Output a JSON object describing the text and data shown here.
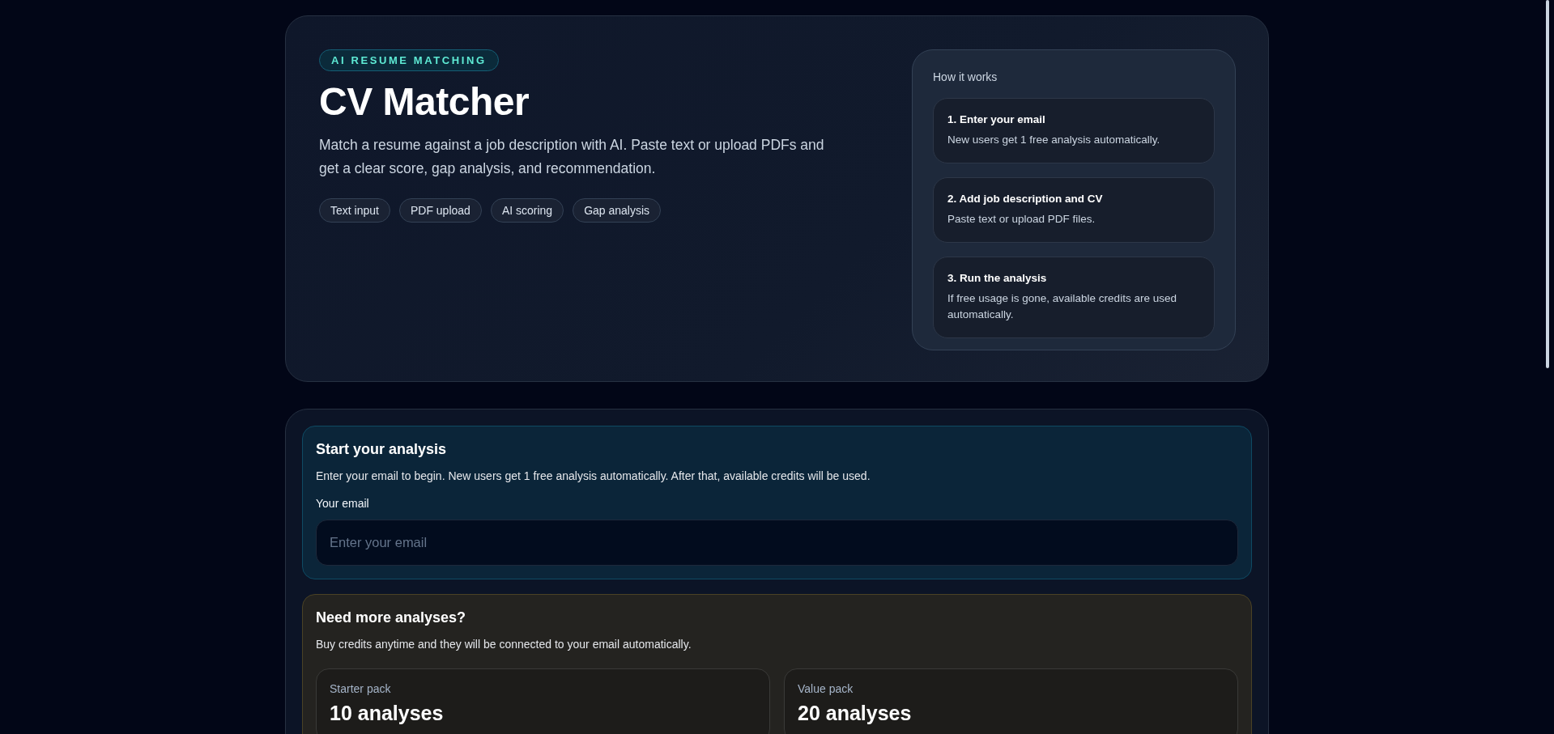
{
  "hero": {
    "badge": "AI RESUME MATCHING",
    "title": "CV Matcher",
    "description": "Match a resume against a job description with AI. Paste text or upload PDFs and get a clear score, gap analysis, and recommendation.",
    "features": [
      "Text input",
      "PDF upload",
      "AI scoring",
      "Gap analysis"
    ]
  },
  "how_it_works": {
    "heading": "How it works",
    "steps": [
      {
        "title": "1. Enter your email",
        "text": "New users get 1 free analysis automatically."
      },
      {
        "title": "2. Add job description and CV",
        "text": "Paste text or upload PDF files."
      },
      {
        "title": "3. Run the analysis",
        "text": "If free usage is gone, available credits are used automatically."
      }
    ]
  },
  "start": {
    "title": "Start your analysis",
    "text": "Enter your email to begin. New users get 1 free analysis automatically. After that, available credits will be used.",
    "email_label": "Your email",
    "email_placeholder": "Enter your email"
  },
  "credits": {
    "title": "Need more analyses?",
    "text": "Buy credits anytime and they will be connected to your email automatically.",
    "packs": [
      {
        "name": "Starter pack",
        "amount": "10 analyses"
      },
      {
        "name": "Value pack",
        "amount": "20 analyses"
      }
    ]
  }
}
